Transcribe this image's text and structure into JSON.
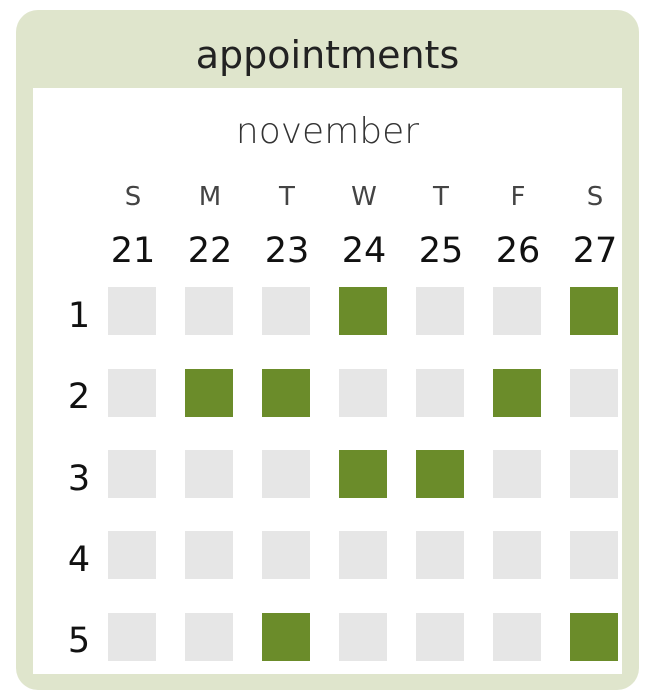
{
  "widget": {
    "title": "appointments",
    "month": "november",
    "days": [
      {
        "dow": "S",
        "date": "21"
      },
      {
        "dow": "M",
        "date": "22"
      },
      {
        "dow": "T",
        "date": "23"
      },
      {
        "dow": "W",
        "date": "24"
      },
      {
        "dow": "T",
        "date": "25"
      },
      {
        "dow": "F",
        "date": "26"
      },
      {
        "dow": "S",
        "date": "27"
      }
    ],
    "rows": [
      {
        "label": "1",
        "booked": [
          false,
          false,
          false,
          true,
          false,
          false,
          true
        ]
      },
      {
        "label": "2",
        "booked": [
          false,
          true,
          true,
          false,
          false,
          true,
          false
        ]
      },
      {
        "label": "3",
        "booked": [
          false,
          false,
          false,
          true,
          true,
          false,
          false
        ]
      },
      {
        "label": "4",
        "booked": [
          false,
          false,
          false,
          false,
          false,
          false,
          false
        ]
      },
      {
        "label": "5",
        "booked": [
          false,
          false,
          true,
          false,
          false,
          false,
          true
        ]
      }
    ]
  },
  "colors": {
    "card_background": "#dfe5cc",
    "booked_slot": "#6b8c2a",
    "free_slot": "#e6e6e6"
  }
}
